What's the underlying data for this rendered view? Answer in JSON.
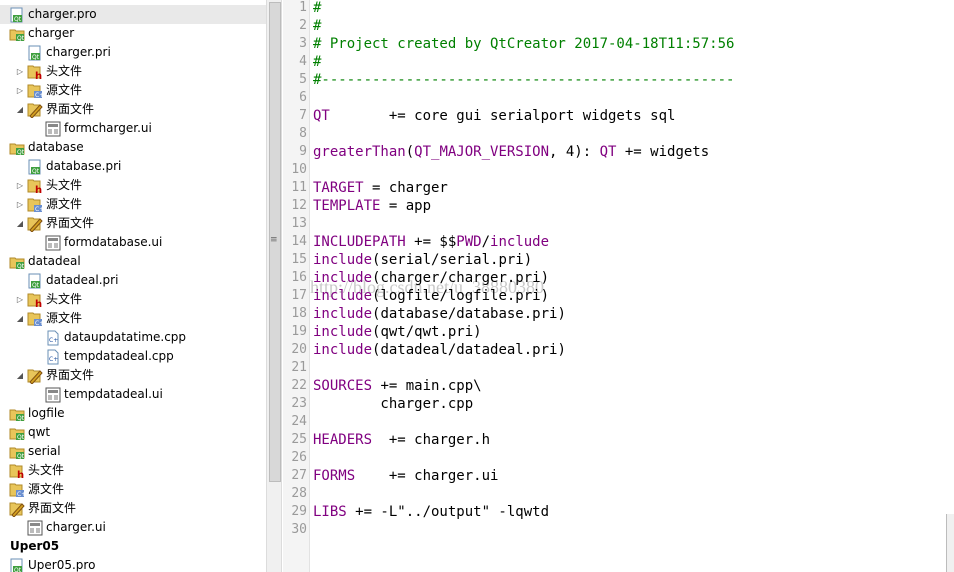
{
  "tree": [
    {
      "label": "charger.pro",
      "level": 0,
      "expand": "",
      "icon": "qt-pro",
      "bold": false,
      "selected": true
    },
    {
      "label": "charger",
      "level": 0,
      "expand": "",
      "icon": "qt-folder",
      "bold": false
    },
    {
      "label": "charger.pri",
      "level": 1,
      "expand": "",
      "icon": "qt-pro",
      "bold": false
    },
    {
      "label": "头文件",
      "level": 1,
      "expand": "right",
      "icon": "headers-folder",
      "bold": false
    },
    {
      "label": "源文件",
      "level": 1,
      "expand": "right",
      "icon": "sources-folder",
      "bold": false
    },
    {
      "label": "界面文件",
      "level": 1,
      "expand": "down",
      "icon": "forms-folder",
      "bold": false
    },
    {
      "label": "formcharger.ui",
      "level": 2,
      "expand": "",
      "icon": "ui-file",
      "bold": false
    },
    {
      "label": "database",
      "level": 0,
      "expand": "",
      "icon": "qt-folder",
      "bold": false
    },
    {
      "label": "database.pri",
      "level": 1,
      "expand": "",
      "icon": "qt-pro",
      "bold": false
    },
    {
      "label": "头文件",
      "level": 1,
      "expand": "right",
      "icon": "headers-folder",
      "bold": false
    },
    {
      "label": "源文件",
      "level": 1,
      "expand": "right",
      "icon": "sources-folder",
      "bold": false
    },
    {
      "label": "界面文件",
      "level": 1,
      "expand": "down",
      "icon": "forms-folder",
      "bold": false
    },
    {
      "label": "formdatabase.ui",
      "level": 2,
      "expand": "",
      "icon": "ui-file",
      "bold": false
    },
    {
      "label": "datadeal",
      "level": 0,
      "expand": "",
      "icon": "qt-folder",
      "bold": false
    },
    {
      "label": "datadeal.pri",
      "level": 1,
      "expand": "",
      "icon": "qt-pro",
      "bold": false
    },
    {
      "label": "头文件",
      "level": 1,
      "expand": "right",
      "icon": "headers-folder",
      "bold": false
    },
    {
      "label": "源文件",
      "level": 1,
      "expand": "down",
      "icon": "sources-folder",
      "bold": false
    },
    {
      "label": "dataupdatatime.cpp",
      "level": 2,
      "expand": "",
      "icon": "cpp-file",
      "bold": false
    },
    {
      "label": "tempdatadeal.cpp",
      "level": 2,
      "expand": "",
      "icon": "cpp-file",
      "bold": false
    },
    {
      "label": "界面文件",
      "level": 1,
      "expand": "down",
      "icon": "forms-folder",
      "bold": false
    },
    {
      "label": "tempdatadeal.ui",
      "level": 2,
      "expand": "",
      "icon": "ui-file",
      "bold": false
    },
    {
      "label": "logfile",
      "level": 0,
      "expand": "",
      "icon": "qt-folder",
      "bold": false
    },
    {
      "label": "qwt",
      "level": 0,
      "expand": "",
      "icon": "qt-folder",
      "bold": false
    },
    {
      "label": "serial",
      "level": 0,
      "expand": "",
      "icon": "qt-folder",
      "bold": false
    },
    {
      "label": "头文件",
      "level": 0,
      "expand": "",
      "icon": "headers-folder",
      "bold": false
    },
    {
      "label": "源文件",
      "level": 0,
      "expand": "",
      "icon": "sources-folder",
      "bold": false
    },
    {
      "label": "界面文件",
      "level": 0,
      "expand": "",
      "icon": "forms-folder",
      "bold": false
    },
    {
      "label": "charger.ui",
      "level": 1,
      "expand": "",
      "icon": "ui-file",
      "bold": false
    },
    {
      "label": "Uper05",
      "level": -1,
      "expand": "",
      "icon": "",
      "bold": true
    },
    {
      "label": "Uper05.pro",
      "level": 0,
      "expand": "",
      "icon": "qt-pro",
      "bold": false
    }
  ],
  "editor": {
    "lines": [
      [
        {
          "t": "#",
          "c": "cm"
        }
      ],
      [
        {
          "t": "#",
          "c": "cm"
        }
      ],
      [
        {
          "t": "# Project created by QtCreator 2017-04-18T11:57:56",
          "c": "cm"
        }
      ],
      [
        {
          "t": "#",
          "c": "cm"
        }
      ],
      [
        {
          "t": "#-------------------------------------------------",
          "c": "cm"
        }
      ],
      [],
      [
        {
          "t": "QT",
          "c": "kw"
        },
        {
          "t": "       += core gui serialport widgets sql",
          "c": ""
        }
      ],
      [],
      [
        {
          "t": "greaterThan",
          "c": "kw"
        },
        {
          "t": "(",
          "c": ""
        },
        {
          "t": "QT_MAJOR_VERSION",
          "c": "vr"
        },
        {
          "t": ", 4): ",
          "c": ""
        },
        {
          "t": "QT",
          "c": "kw"
        },
        {
          "t": " += widgets",
          "c": ""
        }
      ],
      [],
      [
        {
          "t": "TARGET",
          "c": "kw"
        },
        {
          "t": " = charger",
          "c": ""
        }
      ],
      [
        {
          "t": "TEMPLATE",
          "c": "kw"
        },
        {
          "t": " = app",
          "c": ""
        }
      ],
      [],
      [
        {
          "t": "INCLUDEPATH",
          "c": "kw"
        },
        {
          "t": " += $$",
          "c": ""
        },
        {
          "t": "PWD",
          "c": "vr"
        },
        {
          "t": "/",
          "c": ""
        },
        {
          "t": "include",
          "c": "kw"
        }
      ],
      [
        {
          "t": "include",
          "c": "kw"
        },
        {
          "t": "(serial/serial.pri)",
          "c": ""
        }
      ],
      [
        {
          "t": "include",
          "c": "kw"
        },
        {
          "t": "(charger/charger.pri)",
          "c": ""
        }
      ],
      [
        {
          "t": "include",
          "c": "kw"
        },
        {
          "t": "(logfile/logfile.pri)",
          "c": ""
        }
      ],
      [
        {
          "t": "include",
          "c": "kw"
        },
        {
          "t": "(database/database.pri)",
          "c": ""
        }
      ],
      [
        {
          "t": "include",
          "c": "kw"
        },
        {
          "t": "(qwt/qwt.pri)",
          "c": ""
        }
      ],
      [
        {
          "t": "include",
          "c": "kw"
        },
        {
          "t": "(datadeal/datadeal.pri)",
          "c": ""
        }
      ],
      [],
      [
        {
          "t": "SOURCES",
          "c": "kw"
        },
        {
          "t": " += main.cpp\\",
          "c": ""
        }
      ],
      [
        {
          "t": "        charger.cpp",
          "c": ""
        }
      ],
      [],
      [
        {
          "t": "HEADERS",
          "c": "kw"
        },
        {
          "t": "  += charger.h",
          "c": ""
        }
      ],
      [],
      [
        {
          "t": "FORMS",
          "c": "kw"
        },
        {
          "t": "    += charger.ui",
          "c": ""
        }
      ],
      [],
      [
        {
          "t": "LIBS",
          "c": "kw"
        },
        {
          "t": " += -L\"../output\" -lqwtd",
          "c": ""
        }
      ],
      []
    ],
    "watermark": "http://blog.csdn.net/u_38880380"
  },
  "colors": {
    "comment": "#008000",
    "keyword": "#800080",
    "selection": "#e9e9e9"
  }
}
